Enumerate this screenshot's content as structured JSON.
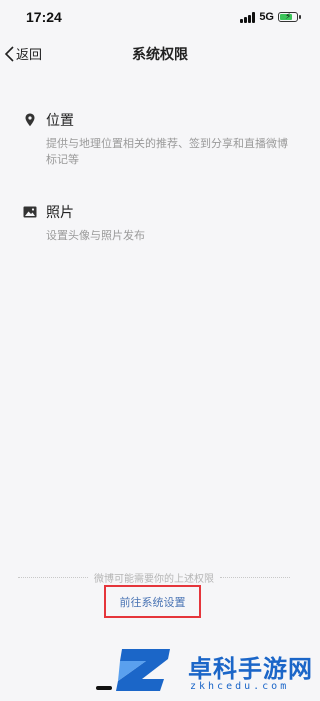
{
  "status_bar": {
    "time": "17:24",
    "network": "5G",
    "icons": [
      "signal-icon",
      "battery-charging-icon"
    ]
  },
  "nav": {
    "back_label": "返回",
    "title": "系统权限"
  },
  "permissions": [
    {
      "icon": "location-pin-icon",
      "title": "位置",
      "description": "提供与地理位置相关的推荐、签到分享和直播微博标记等"
    },
    {
      "icon": "image-icon",
      "title": "照片",
      "description": "设置头像与照片发布"
    }
  ],
  "footer": {
    "hint": "微博可能需要你的上述权限",
    "button_label": "前往系统设置",
    "button_highlight_color": "#e5353b"
  },
  "watermark": {
    "title": "卓科手游网",
    "domain": "zkhcedu.com",
    "color": "#1b66c8"
  }
}
